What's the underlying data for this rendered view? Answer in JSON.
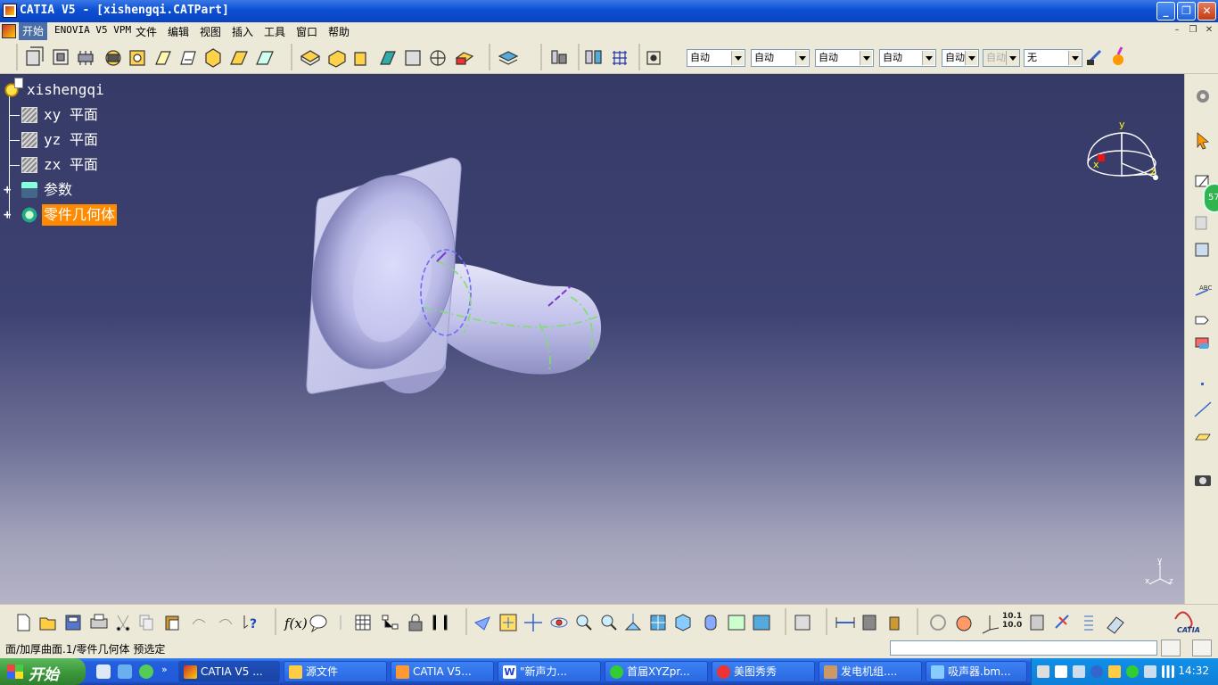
{
  "window": {
    "title": "CATIA V5 - [xishengqi.CATPart]",
    "buttons": {
      "minimize": "_",
      "restore": "❐",
      "close": "✕"
    }
  },
  "menu": {
    "items": [
      "开始",
      "ENOVIA V5 VPM",
      "文件",
      "编辑",
      "视图",
      "插入",
      "工具",
      "窗口",
      "帮助"
    ],
    "mdi": {
      "minimize": "–",
      "restore": "❐",
      "close": "✕"
    }
  },
  "toolbar": {
    "selects": [
      {
        "value": "自动",
        "disabled": false
      },
      {
        "value": "自动",
        "disabled": false
      },
      {
        "value": "自动",
        "disabled": false
      },
      {
        "value": "自动",
        "disabled": false
      },
      {
        "value": "自动",
        "disabled": false
      },
      {
        "value": "自动",
        "disabled": true
      },
      {
        "value": "无",
        "disabled": false
      }
    ]
  },
  "tree": {
    "root": "xishengqi",
    "items": [
      {
        "label": "xy 平面"
      },
      {
        "label": "yz 平面"
      },
      {
        "label": "zx 平面"
      },
      {
        "label": "参数"
      },
      {
        "label": "零件几何体"
      }
    ]
  },
  "compass": {
    "x": "x",
    "y": "y",
    "z": "z"
  },
  "axis_triad": {
    "x": "x",
    "y": "y",
    "z": "z"
  },
  "side_badge": "57",
  "bottom_toolbar": {
    "ratio_label": "10.1\n10.0"
  },
  "statusbar": {
    "text": "面/加厚曲面.1/零件几何体 预选定"
  },
  "taskbar": {
    "start": "开始",
    "tasks": [
      {
        "label": "CATIA V5 ...",
        "active": true
      },
      {
        "label": "源文件",
        "active": false
      },
      {
        "label": "CATIA V5...",
        "active": false
      },
      {
        "label": "\"新声力...",
        "active": false
      },
      {
        "label": "首届XYZpr...",
        "active": false
      },
      {
        "label": "美图秀秀",
        "active": false
      },
      {
        "label": "发电机组....",
        "active": false
      },
      {
        "label": "吸声器.bm...",
        "active": false
      }
    ],
    "clock": "14:32"
  },
  "colors": {
    "viewport_top": "#363a66",
    "viewport_bottom": "#b4b3c6",
    "selected_node": "#ff8a00",
    "part_surface": "#c8c9ee"
  }
}
